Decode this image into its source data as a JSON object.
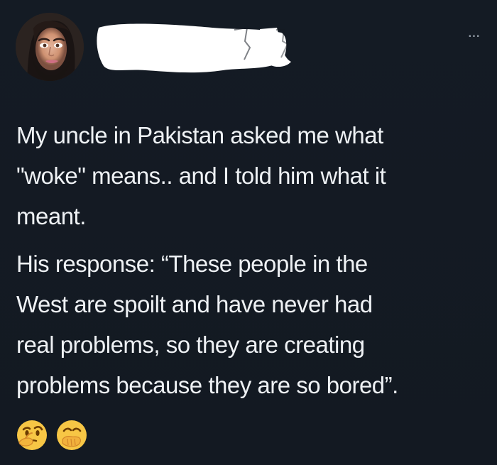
{
  "tweet": {
    "more_label": "...",
    "paragraphs": [
      {
        "lines": [
          "My uncle in Pakistan asked me what",
          "\"woke\" means.. and I told him what it",
          "meant."
        ]
      },
      {
        "lines": [
          "His response: “These people in the",
          "West are spoilt and have never had",
          "real problems, so they are creating",
          "problems because they are so bored”."
        ]
      }
    ],
    "emojis": [
      {
        "name": "thinking-face-icon"
      },
      {
        "name": "face-with-hand-over-mouth-icon"
      }
    ],
    "colors": {
      "background": "#141a22",
      "text": "#eef1f4",
      "muted": "#8f98a2",
      "emoji_yellow": "#f7c645"
    },
    "redaction": {
      "present": true
    }
  }
}
